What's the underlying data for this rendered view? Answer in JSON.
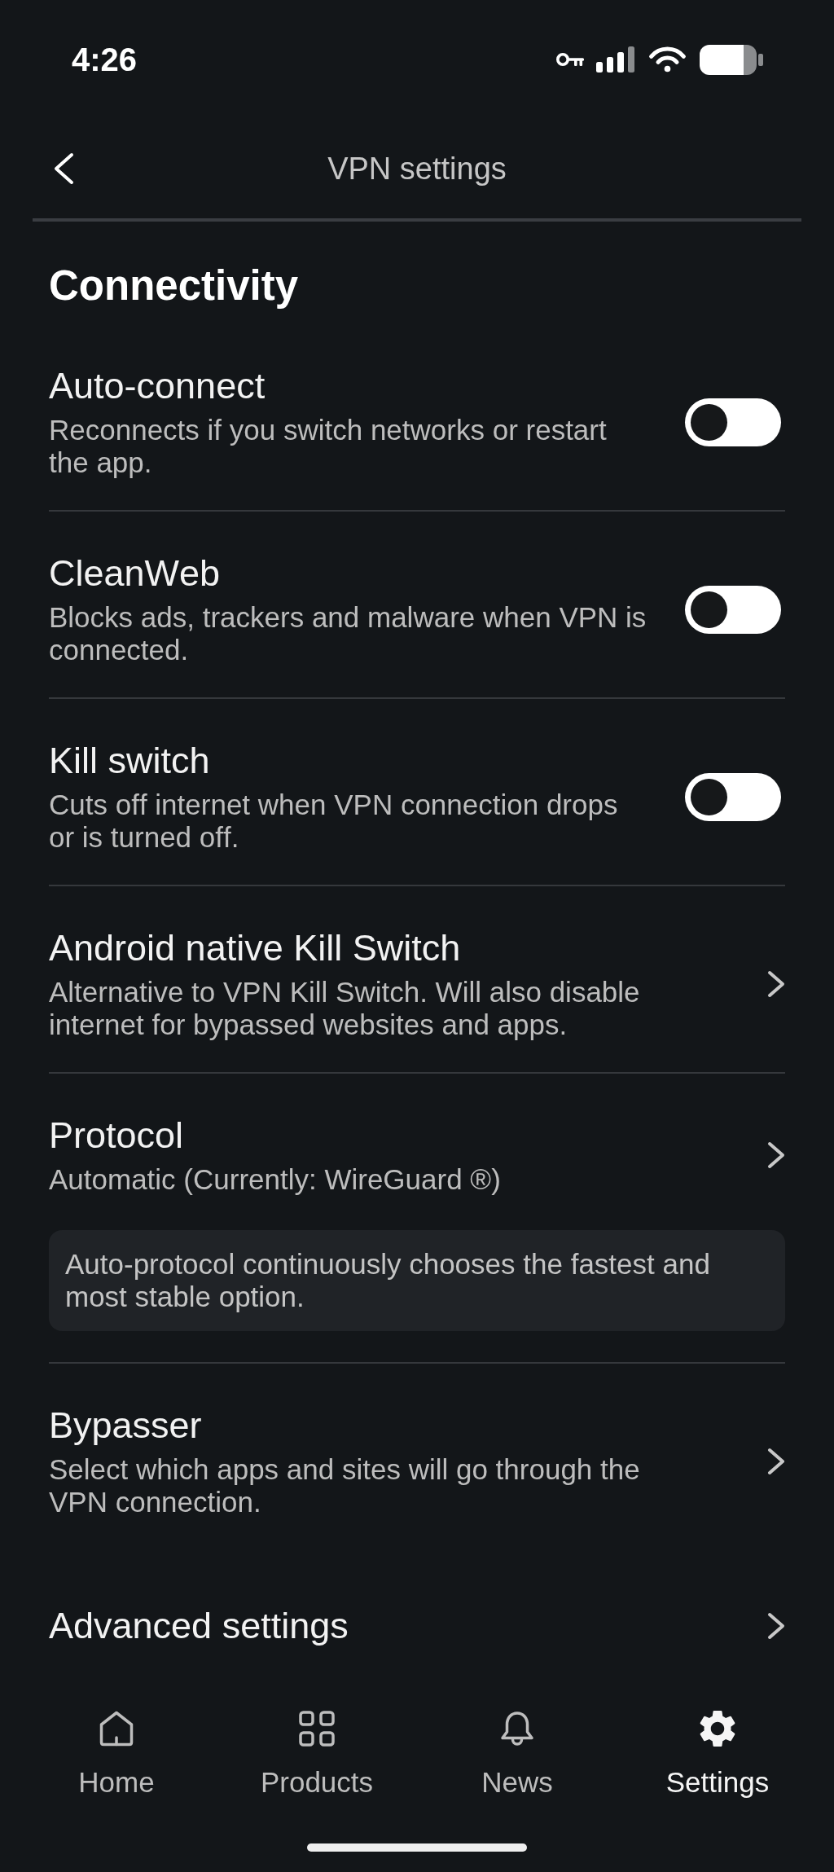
{
  "status_bar": {
    "time": "4:26"
  },
  "header": {
    "title": "VPN settings"
  },
  "section": {
    "title": "Connectivity",
    "items": [
      {
        "kind": "toggle",
        "title": "Auto-connect",
        "description": "Reconnects if you switch networks or restart the app.",
        "on": false
      },
      {
        "kind": "toggle",
        "title": "CleanWeb",
        "description": "Blocks ads, trackers and malware when VPN is connected.",
        "on": false
      },
      {
        "kind": "toggle",
        "title": "Kill switch",
        "description": "Cuts off internet when VPN connection drops or is turned off.",
        "on": false
      },
      {
        "kind": "link",
        "title": "Android native Kill Switch",
        "description": "Alternative to VPN Kill Switch. Will also disable internet for bypassed websites and apps."
      },
      {
        "kind": "link",
        "title": "Protocol",
        "description": "Automatic (Currently: WireGuard ®)",
        "note": "Auto-protocol continuously chooses the fastest and most stable option."
      },
      {
        "kind": "link",
        "title": "Bypasser",
        "description": "Select which apps and sites will go through the VPN connection."
      }
    ]
  },
  "advanced_settings": {
    "label": "Advanced settings"
  },
  "bottom_nav": [
    {
      "label": "Home",
      "selected": false
    },
    {
      "label": "Products",
      "selected": false
    },
    {
      "label": "News",
      "selected": false
    },
    {
      "label": "Settings",
      "selected": true
    }
  ]
}
